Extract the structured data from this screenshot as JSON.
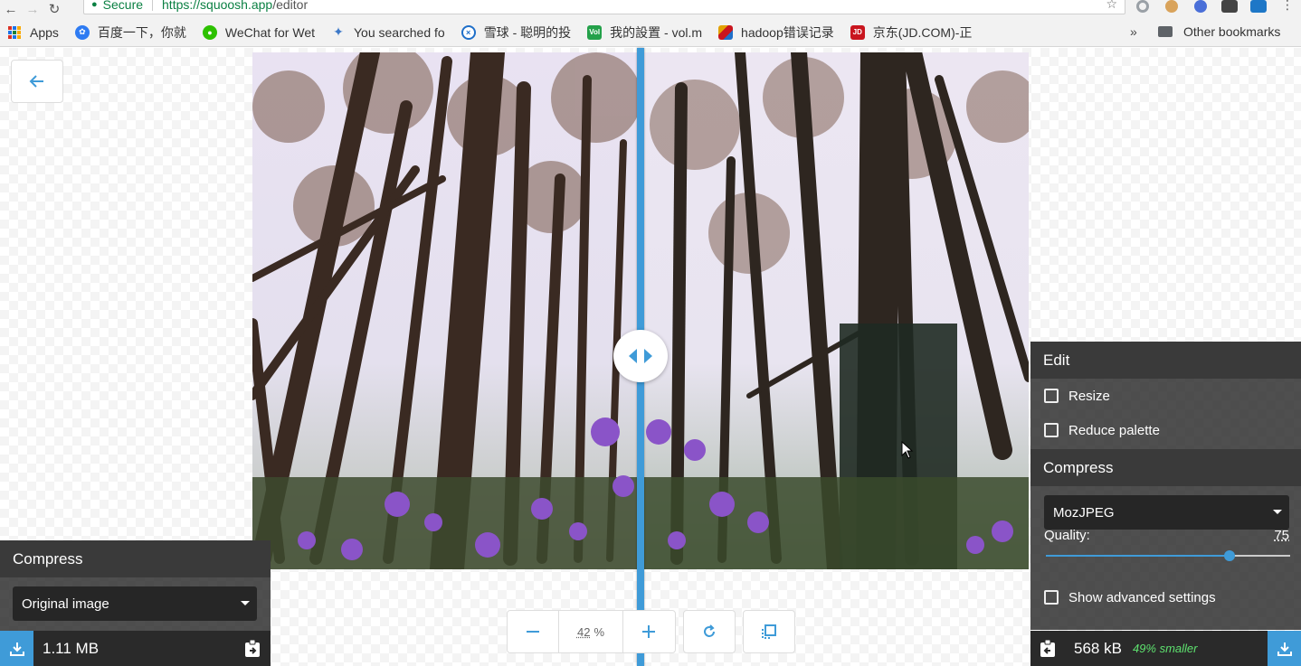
{
  "browser": {
    "secure_label": "Secure",
    "url_origin": "https://squoosh.app",
    "url_path": "/editor",
    "bookmarks": [
      {
        "label": "Apps",
        "icon": "apps-grid-icon",
        "color": "#d93025"
      },
      {
        "label": "百度一下，你就",
        "icon": "baidu-paw-icon",
        "color": "#2e7bf2"
      },
      {
        "label": "WeChat for Wet",
        "icon": "wechat-icon",
        "color": "#2dc100"
      },
      {
        "label": "You searched fo",
        "icon": "search-star-icon",
        "color": "#3c78c8"
      },
      {
        "label": "雪球 - 聪明的投",
        "icon": "xueqiu-icon",
        "color": "#1f6fc9"
      },
      {
        "label": "我的設置 - vol.m",
        "icon": "vol-icon",
        "color": "#24a14a"
      },
      {
        "label": "hadoop错误记录",
        "icon": "hadoop-icon",
        "color": "#e2a100"
      },
      {
        "label": "京东(JD.COM)-正",
        "icon": "jd-icon",
        "color": "#c9151e"
      }
    ],
    "overflow_label": "»",
    "other_bookmarks_label": "Other bookmarks"
  },
  "left_panel": {
    "heading": "Compress",
    "select_value": "Original image",
    "file_size": "1.11 MB"
  },
  "right_panel": {
    "edit_heading": "Edit",
    "resize_label": "Resize",
    "reduce_palette_label": "Reduce palette",
    "compress_heading": "Compress",
    "codec_value": "MozJPEG",
    "quality_label": "Quality:",
    "quality_value": "75",
    "quality_fraction": 0.75,
    "advanced_label": "Show advanced settings",
    "file_size": "568 kB",
    "savings": "49% smaller"
  },
  "zoom": {
    "value": "42",
    "unit": "%"
  },
  "colors": {
    "accent": "#3f9bd8",
    "savings_green": "#5ee26f",
    "panel_dark": "#2a2a2a"
  }
}
